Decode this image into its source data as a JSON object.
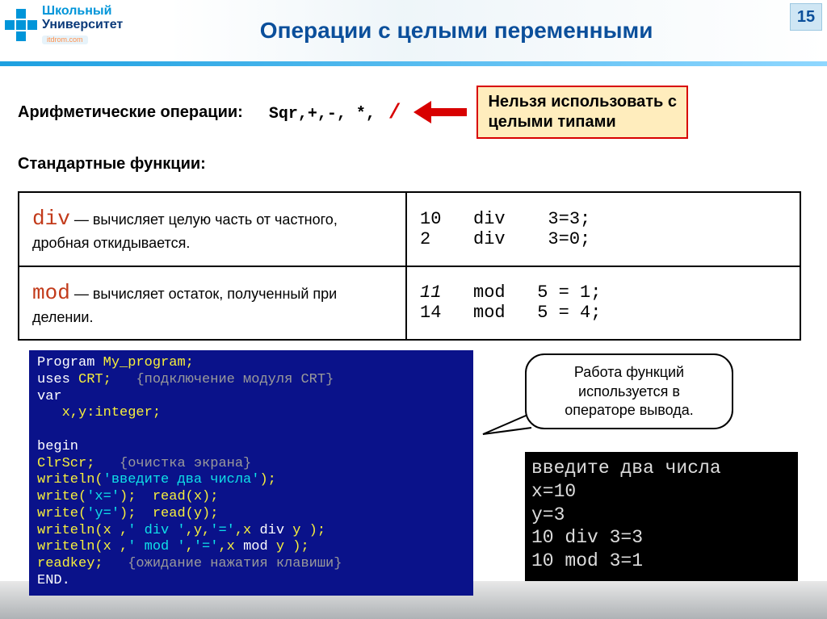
{
  "header": {
    "logo_line1": "Школьный",
    "logo_line2": "Университет",
    "logo_link": "itdrom.com",
    "title": "Операции с целыми переменными",
    "page_number": "15"
  },
  "arith": {
    "label": "Арифметические операции:",
    "ops_prefix": "Sqr,+,-,  *, ",
    "ops_slash": "/",
    "callout_l1": "Нельзя использовать с",
    "callout_l2": "целыми типами"
  },
  "stdfunc_label": "Стандартные функции:",
  "table": {
    "row1": {
      "kw": "div",
      "desc": " — вычисляет целую часть от частного, дробная откидывается.",
      "ex": "10   div    3=3;\n2    div    3=0;"
    },
    "row2": {
      "kw": "mod",
      "desc": " — вычисляет остаток, полученный при делении.",
      "ex_n1": "11",
      "ex_rest1": "   mod   5 = 1;",
      "ex_line2": "14   mod   5 = 4;"
    }
  },
  "code": {
    "l0a": "Program ",
    "l0b": "My_program;",
    "l1a": "uses ",
    "l1b": "CRT;   ",
    "l1c": "{подключение модуля CRT}",
    "l2": "var",
    "l3": "   x,y:integer;",
    "l4": "",
    "l5": "begin",
    "l6a": "ClrScr;   ",
    "l6b": "{очистка экрана}",
    "l7a": "writeln(",
    "l7b": "'введите два числа'",
    "l7c": ");",
    "l8a": "write(",
    "l8b": "'x='",
    "l8c": ");  read(x);",
    "l9a": "write(",
    "l9b": "'y='",
    "l9c": ");  read(y);",
    "l10a": "writeln(x ,",
    "l10b": "' div '",
    "l10c": ",y,",
    "l10d": "'='",
    "l10e": ",x ",
    "l10f": "div",
    "l10g": " y );",
    "l11a": "writeln(x ,",
    "l11b": "' mod '",
    "l11c": ",",
    "l11d": "'='",
    "l11e": ",x ",
    "l11f": "mod",
    "l11g": " y );",
    "l12a": "readkey;   ",
    "l12b": "{ожидание нажатия клавиши}",
    "l13": "END."
  },
  "bubble": {
    "l1": "Работа функций",
    "l2": "используется в",
    "l3": "операторе вывода."
  },
  "output": {
    "l1": "введите два числа",
    "l2": "x=10",
    "l3": "y=3",
    "l4": "10 div 3=3",
    "l5": "10 mod 3=1"
  }
}
